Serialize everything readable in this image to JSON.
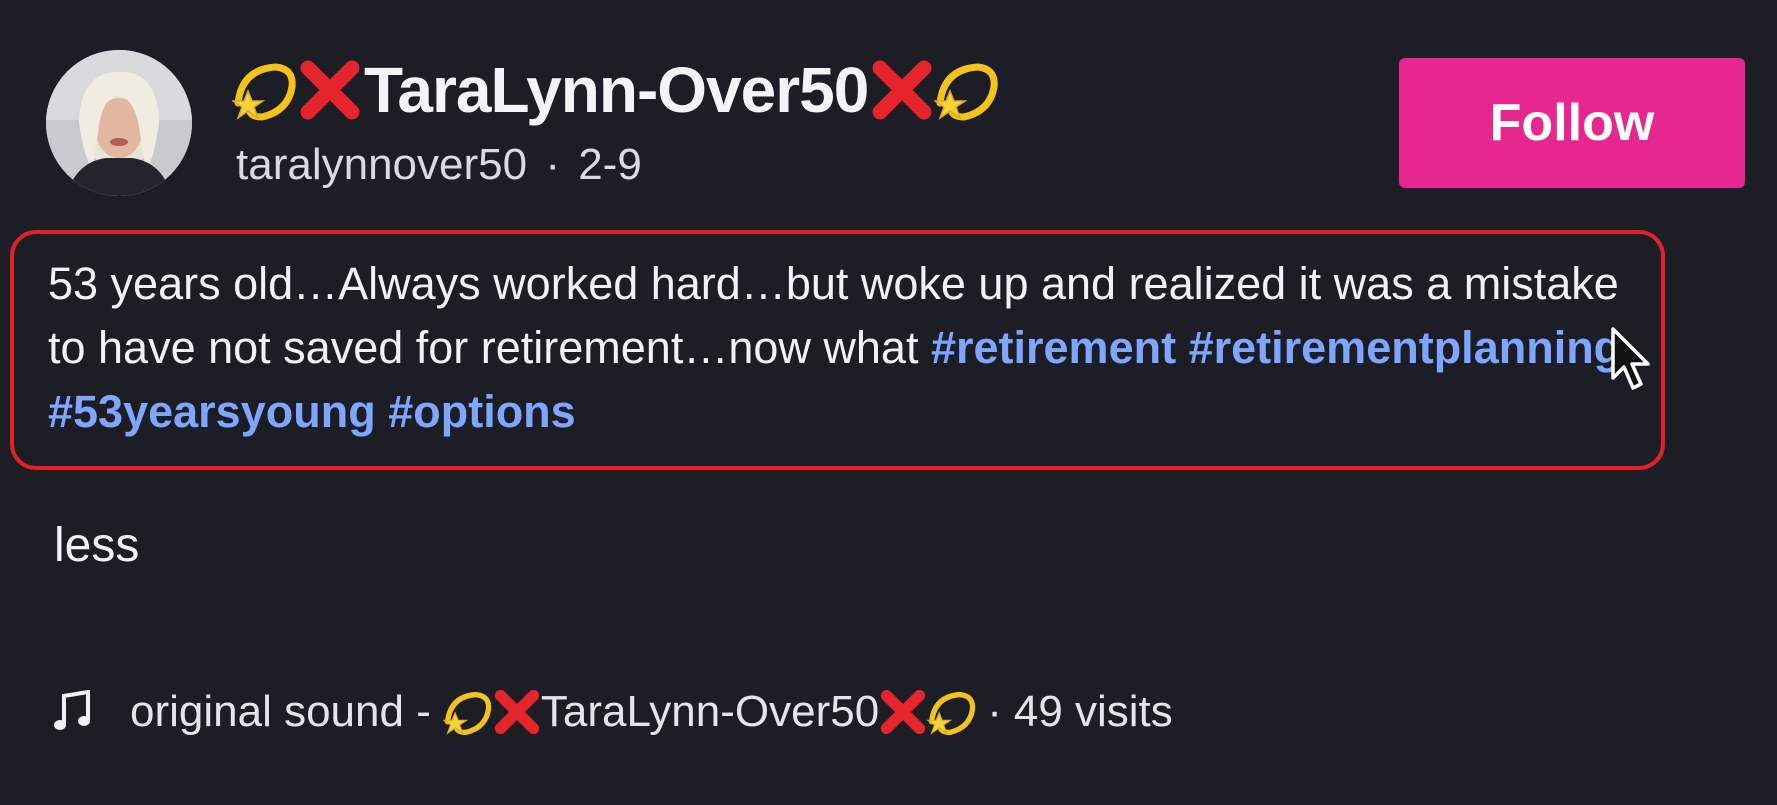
{
  "post": {
    "display_name": "TaraLynn-Over50",
    "username": "taralynnover50",
    "date": "2-9",
    "separator": "·",
    "follow_label": "Follow",
    "caption_text": "53 years old…Always worked hard…but woke up and realized it was a mistake to have not saved for retirement…now what",
    "hashtags": [
      "#retirement",
      "#retirementplanning",
      "#53yearsyoung",
      "#options"
    ],
    "less_label": "less",
    "sound": {
      "prefix": "original sound -",
      "author": "TaraLynn-Over50",
      "separator": "·",
      "visits": "49 visits"
    },
    "name_emoji": [
      "dizzy-icon",
      "cross-mark-icon"
    ]
  },
  "colors": {
    "background": "#1c1d25",
    "follow_button": "#e5278f",
    "hashtag": "#7ea6ff",
    "highlight_border": "#e3202a"
  }
}
